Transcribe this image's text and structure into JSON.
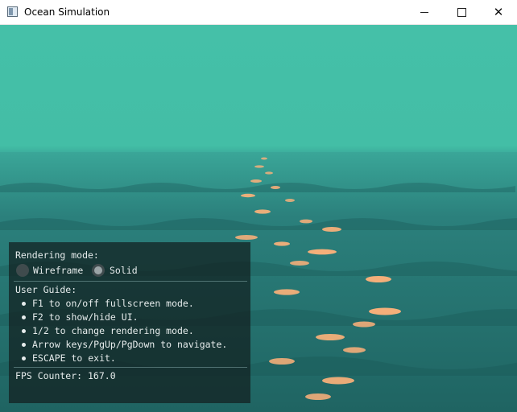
{
  "window": {
    "title": "Ocean Simulation",
    "controls": [
      "minimize",
      "maximize",
      "close"
    ]
  },
  "scene": {
    "sky_color": "#45c0a8",
    "water_color": "#22706d",
    "highlight_color": "#ffb27a"
  },
  "ui_panel": {
    "rendering_mode_label": "Rendering mode:",
    "rendering_modes": [
      {
        "label": "Wireframe",
        "selected": false
      },
      {
        "label": "Solid",
        "selected": true
      }
    ],
    "user_guide_label": "User Guide:",
    "guide_items": [
      "F1 to on/off fullscreen mode.",
      "F2 to show/hide UI.",
      "1/2 to change rendering mode.",
      "Arrow keys/PgUp/PgDown to navigate.",
      "ESCAPE to exit."
    ],
    "fps_counter": "FPS Counter: 167.0"
  }
}
